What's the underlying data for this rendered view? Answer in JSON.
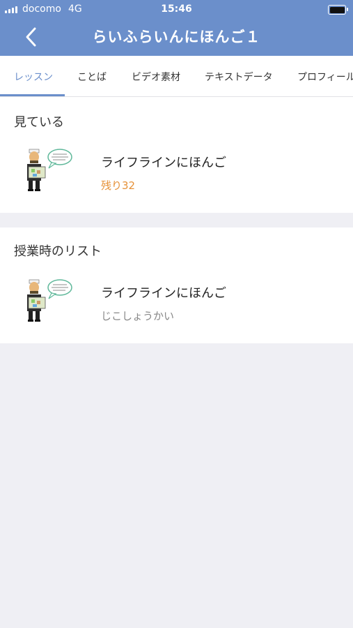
{
  "status_bar": {
    "carrier": "docomo",
    "network": "4G",
    "time": "15:46"
  },
  "nav": {
    "title": "らいふらいんにほんご１"
  },
  "tabs": [
    {
      "label": "レッスン",
      "active": true
    },
    {
      "label": "ことば"
    },
    {
      "label": "ビデオ素材"
    },
    {
      "label": "テキストデータ"
    },
    {
      "label": "プロフィール"
    }
  ],
  "watching": {
    "title": "見ている",
    "items": [
      {
        "title": "ライフラインにほんご",
        "subtitle": "残り32"
      }
    ]
  },
  "class_list": {
    "title": "授業時のリスト",
    "items": [
      {
        "title": "ライフラインにほんご",
        "subtitle": "じこしょうかい"
      }
    ]
  },
  "colors": {
    "header": "#6b8fcb",
    "accent": "#6b8fcb",
    "remaining": "#e69138",
    "background": "#efeff4"
  }
}
